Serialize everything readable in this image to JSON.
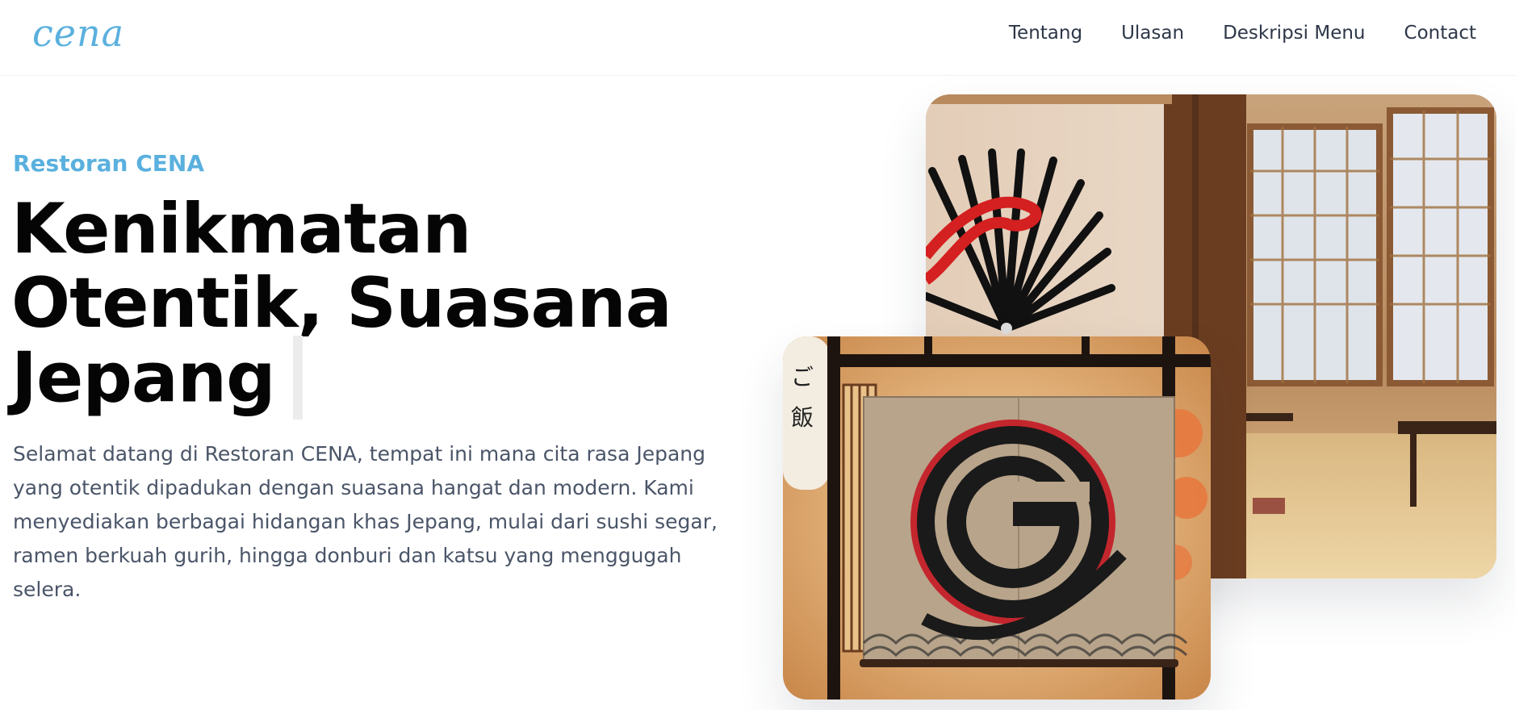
{
  "brand": {
    "logo_text": "cena",
    "accent": "#5ab0de"
  },
  "nav": {
    "items": [
      {
        "label": "Tentang"
      },
      {
        "label": "Ulasan"
      },
      {
        "label": "Deskripsi Menu"
      },
      {
        "label": "Contact"
      }
    ]
  },
  "hero": {
    "eyebrow": "Restoran CENA",
    "headline_lines": [
      "Kenikmatan",
      "Otentik, Suasana",
      "Jepang"
    ],
    "lead": "Selamat datang di Restoran CENA, tempat ini mana cita rasa Jepang yang otentik dipadukan dengan suasana hangat dan modern. Kami menyediakan berbagai hidangan khas Jepang, mulai dari sushi segar, ramen berkuah gurih, hingga donburi dan katsu yang menggugah selera."
  },
  "images": {
    "interior": "japanese-restaurant-interior-photo",
    "noren": "restaurant-entrance-noren-with-logo-photo"
  }
}
